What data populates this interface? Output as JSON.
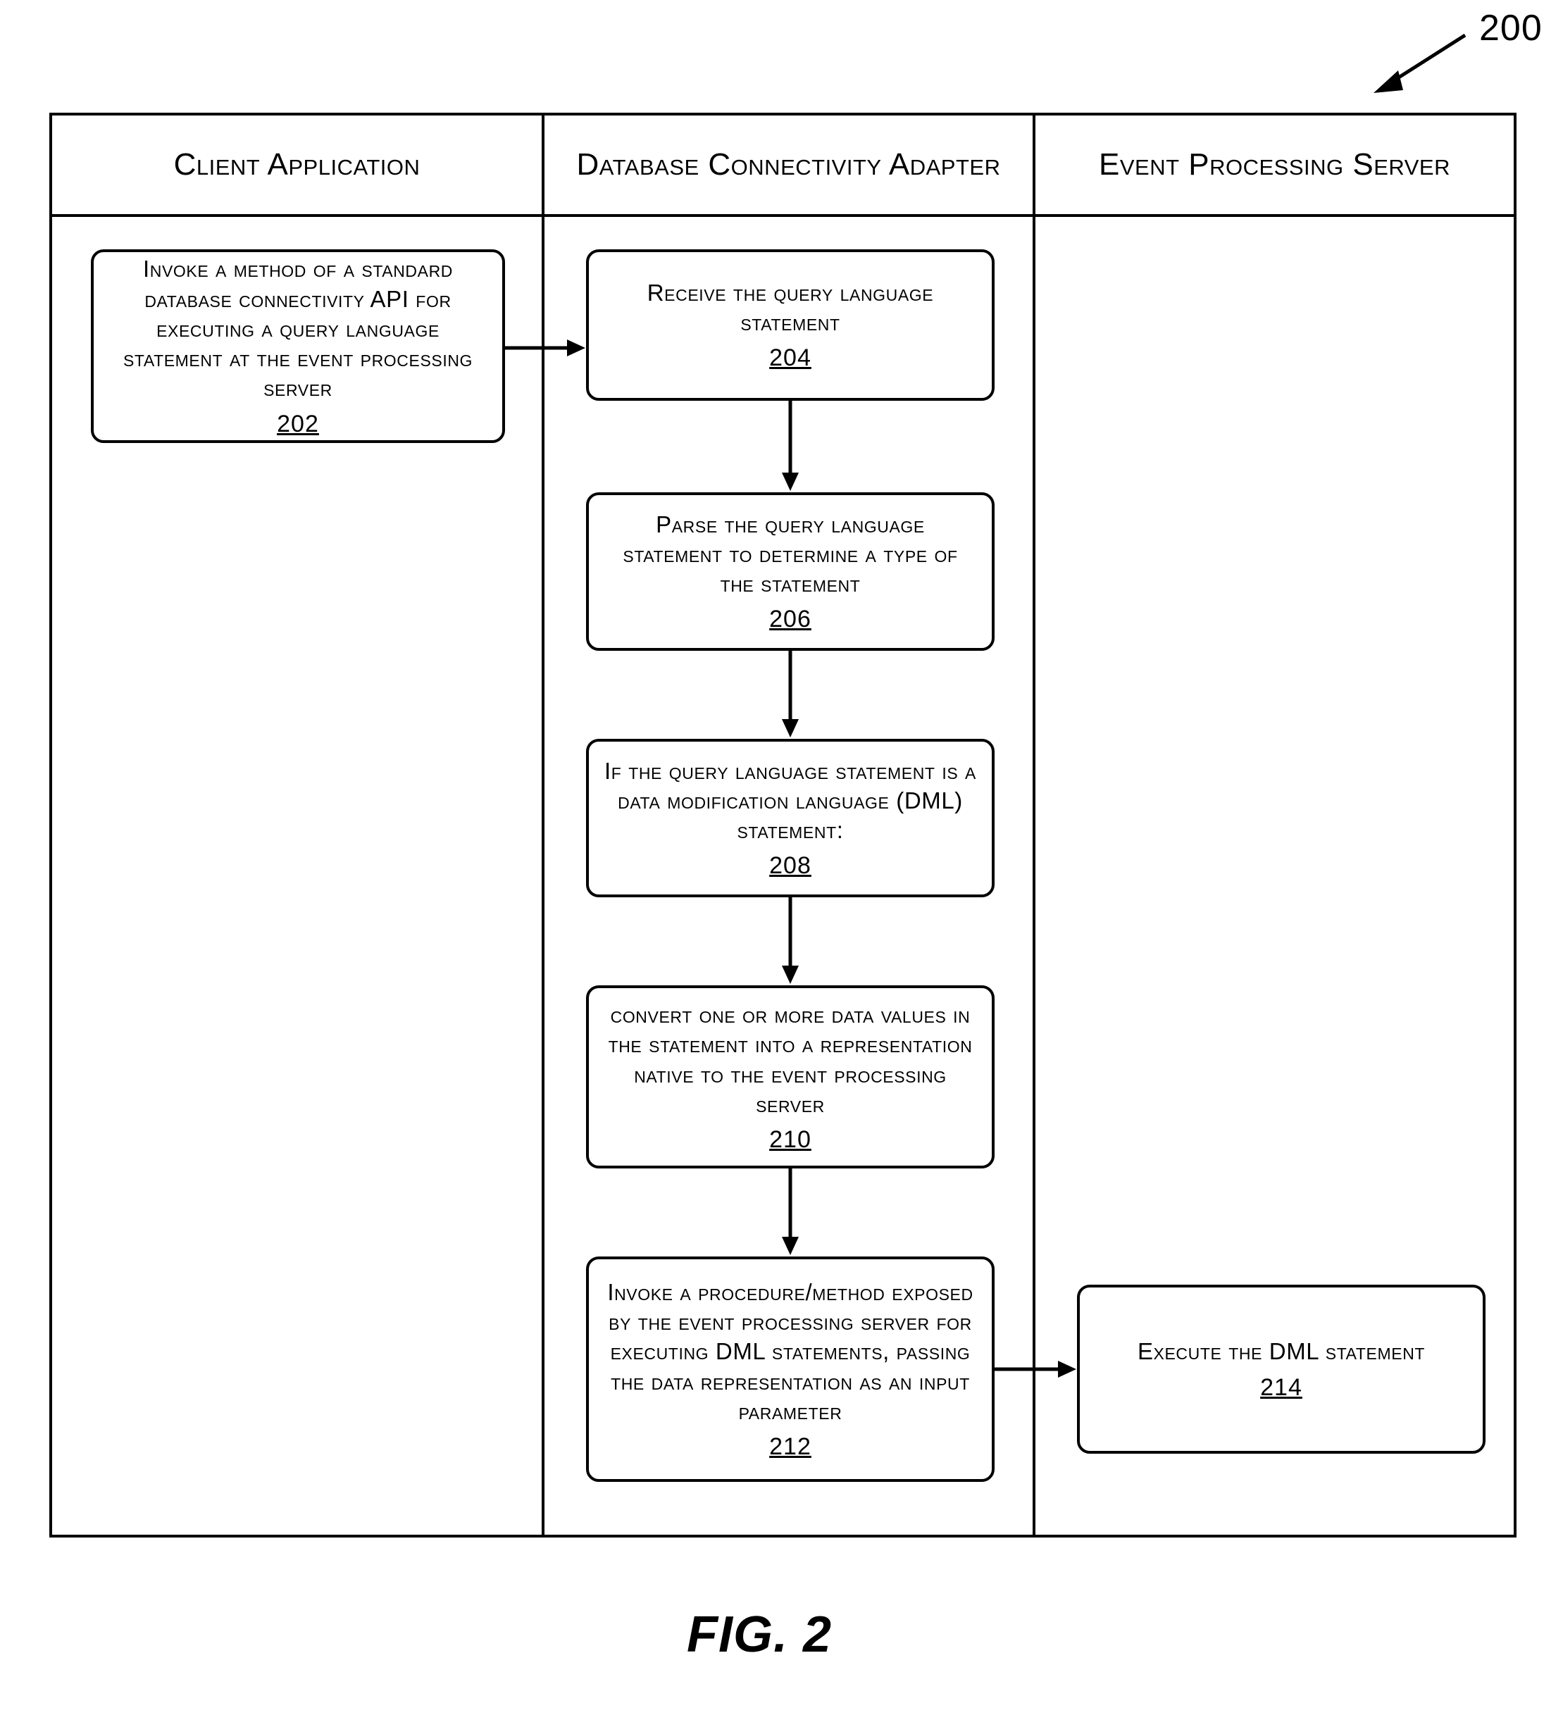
{
  "reference_number": "200",
  "figure_caption": "FIG. 2",
  "lanes": {
    "client": "Client Application",
    "adapter": "Database Connectivity Adapter",
    "server": "Event Processing Server"
  },
  "steps": {
    "s202": {
      "text": "Invoke a method of a standard database connectivity API for executing a query language statement at the event processing server",
      "num": "202"
    },
    "s204": {
      "text": "Receive the query language statement",
      "num": "204"
    },
    "s206": {
      "text": "Parse the query language statement to determine a type of the statement",
      "num": "206"
    },
    "s208": {
      "text": "If the query language statement is a data modification language (DML) statement:",
      "num": "208"
    },
    "s210": {
      "text": "convert one or more data values in the statement into a representation native to the event processing server",
      "num": "210"
    },
    "s212": {
      "text": "Invoke a procedure/method exposed by the event processing server for executing DML statements, passing the data representation as an input parameter",
      "num": "212"
    },
    "s214": {
      "text": "Execute the DML statement",
      "num": "214"
    }
  }
}
